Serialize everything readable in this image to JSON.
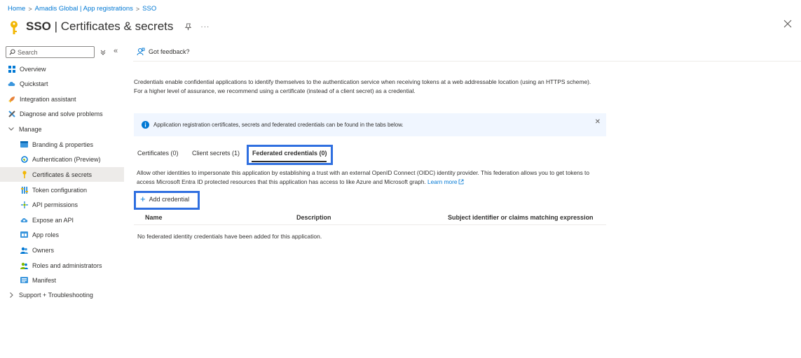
{
  "breadcrumb": {
    "home": "Home",
    "parent": "Amadis Global | App registrations",
    "current": "SSO",
    "sep": ">"
  },
  "header": {
    "title_bold": "SSO",
    "title_rest": " | Certificates & secrets",
    "more": "···"
  },
  "sidebar": {
    "search_placeholder": "Search",
    "collapse": "«",
    "items": [
      {
        "label": "Overview",
        "icon": "grid-icon"
      },
      {
        "label": "Quickstart",
        "icon": "cloud-icon"
      },
      {
        "label": "Integration assistant",
        "icon": "rocket-icon"
      },
      {
        "label": "Diagnose and solve problems",
        "icon": "wrench-icon"
      },
      {
        "label": "Manage",
        "icon": "chevron-down-icon"
      },
      {
        "label": "Branding & properties",
        "icon": "branding-icon"
      },
      {
        "label": "Authentication (Preview)",
        "icon": "authentication-icon"
      },
      {
        "label": "Certificates & secrets",
        "icon": "key-icon"
      },
      {
        "label": "Token configuration",
        "icon": "token-icon"
      },
      {
        "label": "API permissions",
        "icon": "permissions-icon"
      },
      {
        "label": "Expose an API",
        "icon": "cloud-api-icon"
      },
      {
        "label": "App roles",
        "icon": "app-roles-icon"
      },
      {
        "label": "Owners",
        "icon": "owners-icon"
      },
      {
        "label": "Roles and administrators",
        "icon": "roles-icon"
      },
      {
        "label": "Manifest",
        "icon": "manifest-icon"
      },
      {
        "label": "Support + Troubleshooting",
        "icon": "chevron-right-icon"
      }
    ]
  },
  "toolbar": {
    "feedback": "Got feedback?"
  },
  "content": {
    "intro": "Credentials enable confidential applications to identify themselves to the authentication service when receiving tokens at a web addressable location (using an HTTPS scheme). For a higher level of assurance, we recommend using a certificate (instead of a client secret) as a credential.",
    "info": "Application registration certificates, secrets and federated credentials can be found in the tabs below.",
    "info_close": "✕",
    "tabs": [
      {
        "label": "Certificates (0)"
      },
      {
        "label": "Client secrets (1)"
      },
      {
        "label": "Federated credentials (0)"
      }
    ],
    "description": "Allow other identities to impersonate this application by establishing a trust with an external OpenID Connect (OIDC) identity provider. This federation allows you to get tokens to access Microsoft Entra ID protected resources that this application has access to like Azure and Microsoft graph.",
    "learn_more": "Learn more",
    "add_credential": "Add credential",
    "add_plus": "+",
    "columns": [
      "Name",
      "Description",
      "Subject identifier or claims matching expression"
    ],
    "empty": "No federated identity credentials have been added for this application."
  },
  "colors": {
    "accent": "#0078d4",
    "highlight": "#2f6fe0",
    "key": "#f2b705"
  }
}
